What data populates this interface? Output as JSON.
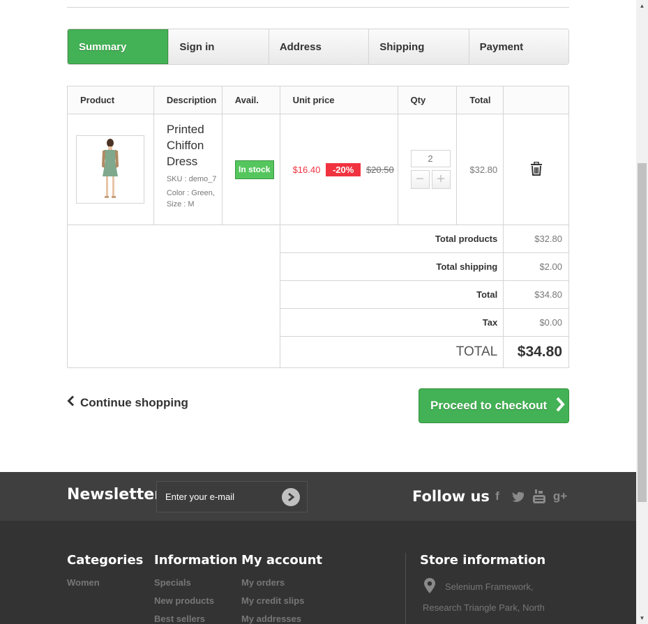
{
  "steps": [
    "Summary",
    "Sign in",
    "Address",
    "Shipping",
    "Payment"
  ],
  "table": {
    "headers": [
      "Product",
      "Description",
      "Avail.",
      "Unit price",
      "Qty",
      "Total"
    ],
    "item": {
      "name": "Printed Chiffon Dress",
      "sku": "SKU : demo_7",
      "attributes": "Color : Green, Size : M",
      "availability": "In stock",
      "price_new": "$16.40",
      "discount": "-20%",
      "price_old": "$20.50",
      "qty": "2",
      "total": "$32.80"
    },
    "summary": [
      {
        "label": "Total products",
        "value": "$32.80"
      },
      {
        "label": "Total shipping",
        "value": "$2.00"
      },
      {
        "label": "Total",
        "value": "$34.80"
      },
      {
        "label": "Tax",
        "value": "$0.00"
      }
    ],
    "grand_total": {
      "label": "TOTAL",
      "value": "$34.80"
    }
  },
  "actions": {
    "continue": "Continue shopping",
    "checkout": "Proceed to checkout"
  },
  "footer": {
    "newsletter_title": "Newsletter",
    "newsletter_placeholder": "Enter your e-mail",
    "follow_title": "Follow us",
    "social_icons": [
      "facebook-icon",
      "twitter-icon",
      "youtube-icon",
      "google-plus-icon"
    ],
    "categories": {
      "title": "Categories",
      "links": [
        "Women"
      ]
    },
    "information": {
      "title": "Information",
      "links": [
        "Specials",
        "New products",
        "Best sellers"
      ]
    },
    "account": {
      "title": "My account",
      "links": [
        "My orders",
        "My credit slips",
        "My addresses"
      ]
    },
    "store": {
      "title": "Store information",
      "lines": [
        "Selenium Framework,",
        "Research Triangle Park, North"
      ]
    }
  },
  "colors": {
    "accent": "#43b155",
    "sale": "#f13340",
    "footer": "#333333"
  }
}
